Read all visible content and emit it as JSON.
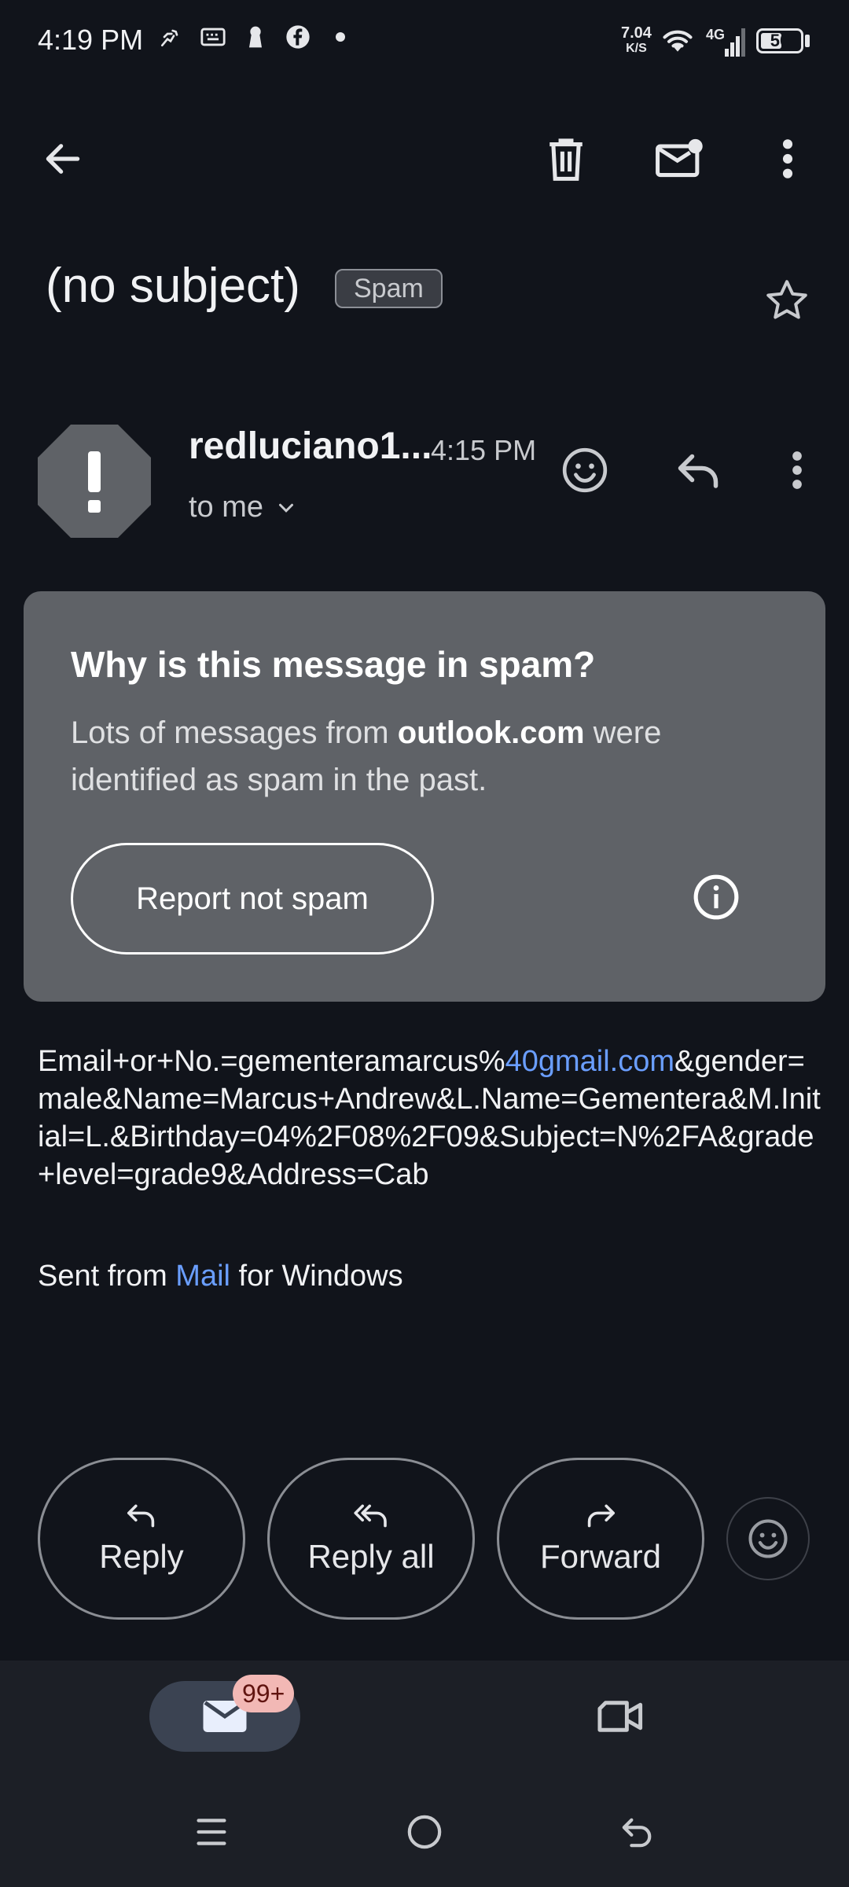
{
  "status_bar": {
    "time": "4:19 PM",
    "net_speed_value": "7.04",
    "net_speed_unit": "K/S",
    "network_type": "4G",
    "battery": "50",
    "icons": [
      "activity-icon",
      "keyboard-icon",
      "keyhole-icon",
      "facebook-icon",
      "dot-icon",
      "wifi-icon",
      "signal-icon",
      "battery-icon"
    ]
  },
  "toolbar": {
    "back_icon": "arrow-back-icon",
    "delete_icon": "trash-icon",
    "mark_unread_icon": "mail-unread-icon",
    "more_icon": "more-vert-icon"
  },
  "email": {
    "subject": "(no subject)",
    "label": "Spam",
    "sender_name": "redluciano1...",
    "time": "4:15 PM",
    "recipient": "to me",
    "body_prefix": "Email+or+No.=gementeramarcus%",
    "body_link": "40gmail.com",
    "body_suffix": "&gender=male&Name=Marcus+Andrew&L.Name=Gementera&M.Initial=L.&Birthday=04%2F08%2F09&Subject=N%2FA&grade+level=grade9&Address=Cab",
    "signature_prefix": "Sent from ",
    "signature_link": "Mail",
    "signature_suffix": " for Windows"
  },
  "spam_card": {
    "title": "Why is this message in spam?",
    "body_prefix": "Lots of messages from ",
    "body_domain": "outlook.com",
    "body_suffix": " were identified as spam in the past.",
    "button_label": "Report not spam"
  },
  "actions": {
    "reply": "Reply",
    "reply_all": "Reply all",
    "forward": "Forward"
  },
  "bottom_nav": {
    "mail_badge": "99+"
  },
  "colors": {
    "background": "#11141b",
    "card": "#5f6267",
    "link": "#6a9eff",
    "badge": "#f2b8b5"
  }
}
